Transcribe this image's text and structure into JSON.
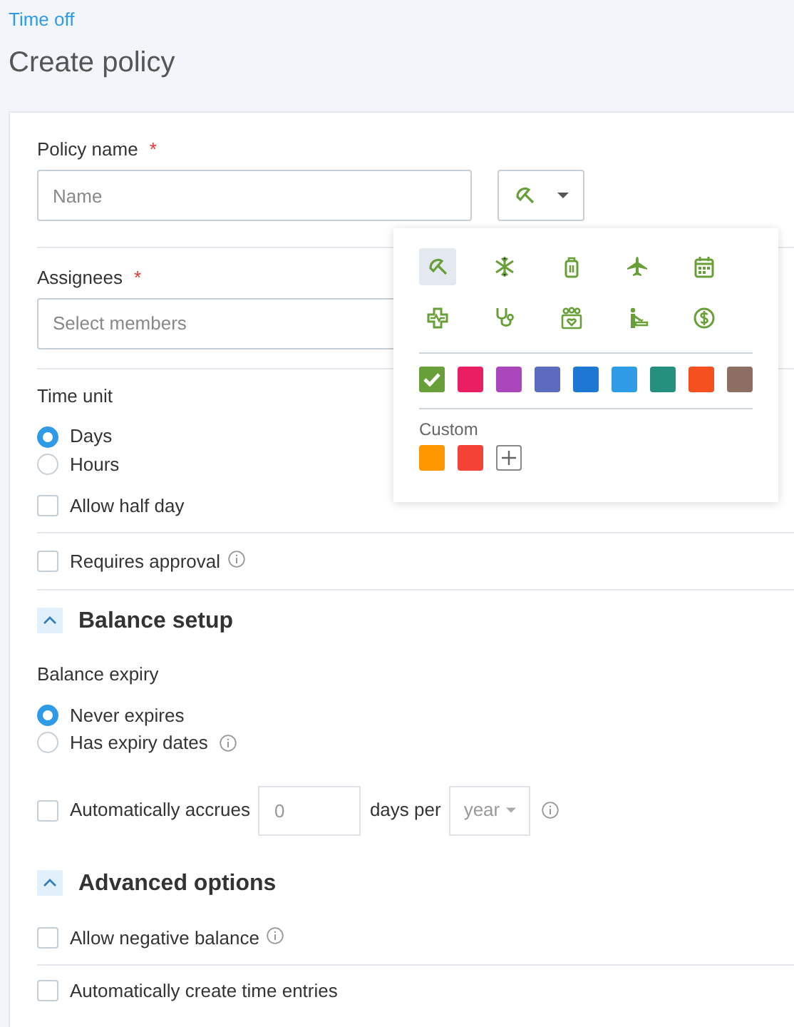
{
  "breadcrumb": "Time off",
  "title": "Create policy",
  "policy_name": {
    "label": "Policy name",
    "required_mark": "*",
    "placeholder": "Name"
  },
  "icon_picker": {
    "open": true,
    "icons": [
      {
        "kind": "umbrella",
        "selected": true
      },
      {
        "kind": "snowflake",
        "selected": false
      },
      {
        "kind": "suitcase",
        "selected": false
      },
      {
        "kind": "plane",
        "selected": false
      },
      {
        "kind": "calendar",
        "selected": false
      },
      {
        "kind": "medical",
        "selected": false
      },
      {
        "kind": "stethoscope",
        "selected": false
      },
      {
        "kind": "family",
        "selected": false
      },
      {
        "kind": "bath",
        "selected": false
      },
      {
        "kind": "dollar",
        "selected": false
      }
    ],
    "colors": [
      {
        "color": "#689f38",
        "selected": true
      },
      {
        "color": "#e91e63",
        "selected": false
      },
      {
        "color": "#ab47bc",
        "selected": false
      },
      {
        "color": "#5c6bc0",
        "selected": false
      },
      {
        "color": "#1e77d3",
        "selected": false
      },
      {
        "color": "#2f9be6",
        "selected": false
      },
      {
        "color": "#26907f",
        "selected": false
      },
      {
        "color": "#f4511e",
        "selected": false
      },
      {
        "color": "#8d6e63",
        "selected": false
      }
    ],
    "custom_label": "Custom",
    "custom_colors": [
      {
        "color": "#ff9800",
        "selected": false
      },
      {
        "color": "#f44336",
        "selected": false
      }
    ]
  },
  "assignees": {
    "label": "Assignees",
    "required_mark": "*",
    "placeholder": "Select members"
  },
  "time_unit": {
    "label": "Time unit",
    "options": [
      {
        "label": "Days",
        "selected": true
      },
      {
        "label": "Hours",
        "selected": false
      }
    ]
  },
  "allow_half_day": {
    "label": "Allow half day",
    "checked": false
  },
  "requires_approval": {
    "label": "Requires approval",
    "checked": false,
    "info": true
  },
  "balance_setup": {
    "title": "Balance setup",
    "expanded": true,
    "expiry_label": "Balance expiry",
    "expiry_options": [
      {
        "label": "Never expires",
        "selected": true,
        "info": false
      },
      {
        "label": "Has expiry dates",
        "selected": false,
        "info": true
      }
    ],
    "accrual": {
      "label": "Automatically accrues",
      "checked": false,
      "amount_placeholder": "0",
      "unit_text": "days per",
      "period": "year",
      "disabled": true,
      "info": true
    }
  },
  "advanced_options": {
    "title": "Advanced options",
    "expanded": true,
    "options": [
      {
        "label": "Allow negative balance",
        "checked": false,
        "info": true
      },
      {
        "label": "Automatically create time entries",
        "checked": false,
        "info": false
      }
    ]
  }
}
